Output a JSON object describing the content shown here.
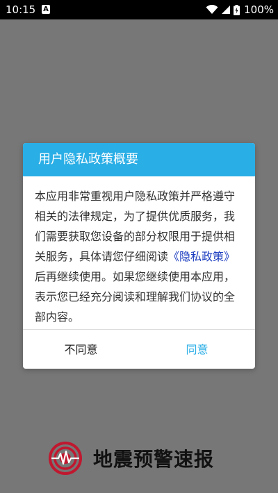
{
  "status_bar": {
    "time": "10:15",
    "notification_icon": "A",
    "battery_percent": "100%"
  },
  "dialog": {
    "title": "用户隐私政策概要",
    "body_before": "本应用非常重视用户隐私政策并严格遵守相关的法律规定，为了提供优质服务，我们需要获取您设备的部分权限用于提供相关服务，具体请您仔细阅读",
    "policy_link": "《隐私政策》",
    "body_after": "后再继续使用。如果您继续使用本应用，表示您已经充分阅读和理解我们协议的全部内容。",
    "disagree_label": "不同意",
    "agree_label": "同意",
    "accent_color": "#2aaee6"
  },
  "brand": {
    "app_name": "地震预警速报"
  }
}
